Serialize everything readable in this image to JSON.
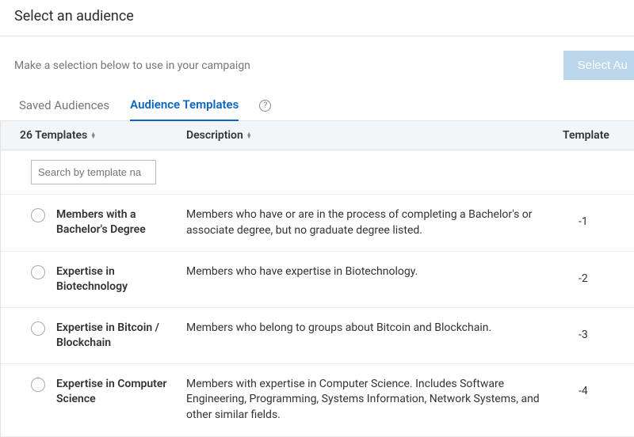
{
  "header": {
    "title": "Select an audience"
  },
  "toolbar": {
    "instruction": "Make a selection below to use in your campaign",
    "select_button": "Select Au"
  },
  "tabs": {
    "saved": "Saved Audiences",
    "templates": "Audience Templates"
  },
  "table": {
    "count_label": "26 Templates",
    "description_label": "Description",
    "size_label": "Template",
    "search_placeholder": "Search by template na"
  },
  "rows": [
    {
      "name": "Members with a Bachelor's Degree",
      "desc": "Members who have or are in the process of completing a Bachelor's or associate degree, but no graduate degree listed.",
      "size": "-1"
    },
    {
      "name": "Expertise in Biotechnology",
      "desc": "Members who have expertise in Biotechnology.",
      "size": "-2"
    },
    {
      "name": "Expertise in Bitcoin / Blockchain",
      "desc": "Members who belong to groups about Bitcoin and Blockchain.",
      "size": "-3"
    },
    {
      "name": "Expertise in Computer Science",
      "desc": "Members with expertise in Computer Science. Includes Software Engineering, Programming, Systems Information, Network Systems, and other similar fields.",
      "size": "-4"
    }
  ]
}
